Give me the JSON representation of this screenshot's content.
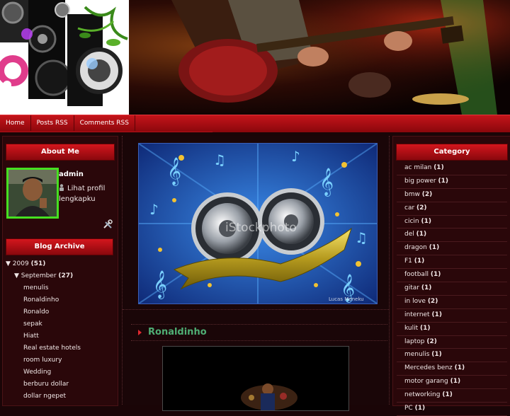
{
  "nav": {
    "items": [
      "Home",
      "Posts RSS",
      "Comments RSS"
    ]
  },
  "header": {
    "left_watermark": "",
    "right_watermark": ""
  },
  "about": {
    "title": "About Me",
    "name": "admin",
    "profile_link": "Lihat profil lengkapku"
  },
  "archive": {
    "title": "Blog Archive",
    "year": {
      "label": "2009",
      "count": "(51)"
    },
    "month": {
      "label": "September",
      "count": "(27)"
    },
    "posts": [
      "menulis",
      "Ronaldinho",
      "Ronaldo",
      "sepak",
      "Hiatt",
      "Real estate hotels",
      "room luxury",
      "Wedding",
      "berburu dollar",
      "dollar ngepet"
    ]
  },
  "banner": {
    "watermark": "iStockphoto",
    "credit": "Lucas Meneku"
  },
  "post": {
    "title": "Ronaldinho"
  },
  "category": {
    "title": "Category",
    "items": [
      {
        "label": "ac milan",
        "count": "(1)"
      },
      {
        "label": "big power",
        "count": "(1)"
      },
      {
        "label": "bmw",
        "count": "(2)"
      },
      {
        "label": "car",
        "count": "(2)"
      },
      {
        "label": "cicin",
        "count": "(1)"
      },
      {
        "label": "del",
        "count": "(1)"
      },
      {
        "label": "dragon",
        "count": "(1)"
      },
      {
        "label": "F1",
        "count": "(1)"
      },
      {
        "label": "football",
        "count": "(1)"
      },
      {
        "label": "gitar",
        "count": "(1)"
      },
      {
        "label": "in love",
        "count": "(2)"
      },
      {
        "label": "internet",
        "count": "(1)"
      },
      {
        "label": "kulit",
        "count": "(1)"
      },
      {
        "label": "laptop",
        "count": "(2)"
      },
      {
        "label": "menulis",
        "count": "(1)"
      },
      {
        "label": "Mercedes benz",
        "count": "(1)"
      },
      {
        "label": "motor garang",
        "count": "(1)"
      },
      {
        "label": "networking",
        "count": "(1)"
      },
      {
        "label": "PC",
        "count": "(1)"
      }
    ]
  },
  "colors": {
    "accent": "#c4141a",
    "title_green": "#4fae74",
    "avatar_border": "#46e021"
  }
}
